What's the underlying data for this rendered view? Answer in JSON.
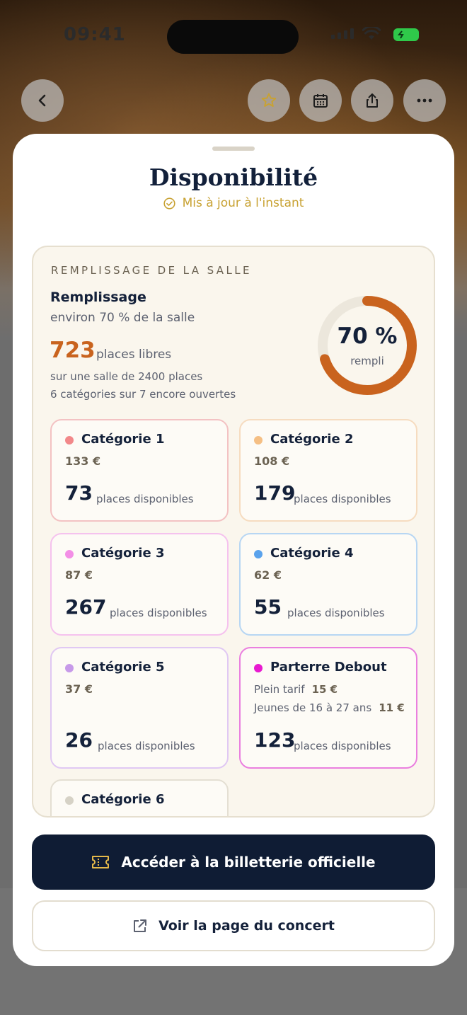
{
  "status_bar": {
    "time": "09:41"
  },
  "sheet": {
    "title": "Disponibilité",
    "updated": "Mis à jour à l'instant"
  },
  "occupancy": {
    "section_heading": "REMPLISSAGE DE LA SALLE",
    "title": "Remplissage",
    "subtitle": "environ 70 % de la salle",
    "free_count": "723",
    "free_label": "places libres",
    "hall_line": "sur une salle de 2400 places",
    "categories_line": "6 catégories sur 7 encore ouvertes",
    "donut_percent": "70 %",
    "donut_label": "rempli",
    "fill_fraction": 0.7,
    "colors": {
      "accent": "#c9631e",
      "track": "#ece7dc"
    }
  },
  "categories": [
    {
      "name": "Catégorie 1",
      "price": "133 €",
      "count": "73",
      "avail": "places disponibles",
      "dot": "#f2888a",
      "border": "#f3c2c3"
    },
    {
      "name": "Catégorie 2",
      "price": "108 €",
      "count": "179",
      "avail": "places disponibles",
      "dot": "#f5bf84",
      "border": "#f6dcc0"
    },
    {
      "name": "Catégorie 3",
      "price": "87 €",
      "count": "267",
      "avail": "places disponibles",
      "dot": "#f38ee6",
      "border": "#f5c2ee"
    },
    {
      "name": "Catégorie 4",
      "price": "62 €",
      "count": "55",
      "avail": "places disponibles",
      "dot": "#5aa2ec",
      "border": "#b7d6f3"
    },
    {
      "name": "Catégorie 5",
      "price": "37 €",
      "count": "26",
      "avail": "places disponibles",
      "dot": "#c79ae9",
      "border": "#e0c8f3"
    },
    {
      "name": "Parterre Debout",
      "line1_label": "Plein tarif",
      "line1_price": "15 €",
      "line2_label": "Jeunes de 16 à 27 ans",
      "line2_price": "11 €",
      "count": "123",
      "avail": "places disponibles",
      "dot": "#e81ad0",
      "border": "#ea7fdf"
    },
    {
      "name": "Catégorie 6",
      "dot": "#d6d2c6",
      "border": "#e4dfd3"
    }
  ],
  "actions": {
    "primary_label": "Accéder à la billetterie officielle",
    "secondary_label": "Voir la page du concert"
  },
  "icons": {
    "back": "chevron-left-icon",
    "favorite": "star-icon",
    "calendar": "calendar-icon",
    "share": "share-icon",
    "more": "more-icon",
    "updated": "check-circle-icon",
    "ticket": "ticket-icon",
    "external": "external-link-icon"
  }
}
